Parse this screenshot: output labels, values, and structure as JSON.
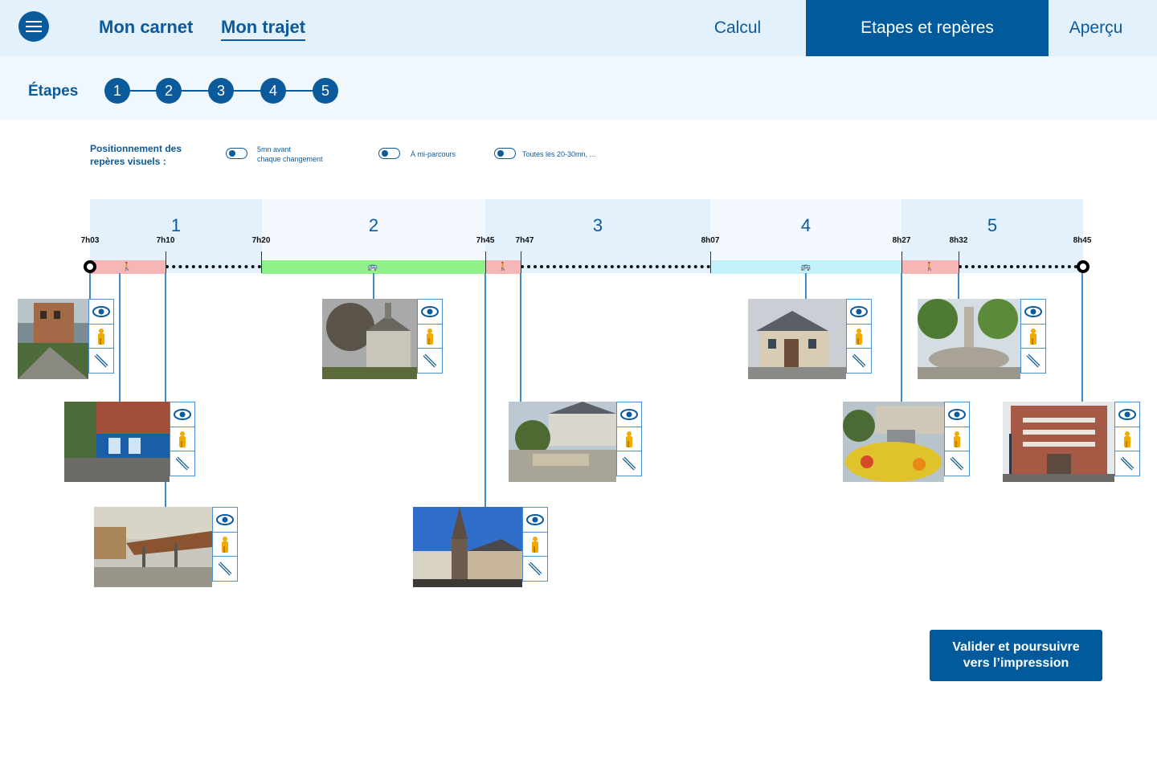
{
  "nav": {
    "menu_icon": "hamburger-icon",
    "links": [
      "Mon carnet",
      "Mon trajet"
    ],
    "tabs": [
      "Calcul",
      "Etapes et repères",
      "Aperçu"
    ]
  },
  "steps": {
    "label": "Étapes",
    "numbers": [
      "1",
      "2",
      "3",
      "4",
      "5"
    ]
  },
  "options": {
    "title": "Positionnement des repères visuels :",
    "items": [
      {
        "line1": "5mn avant",
        "line2": "chaque changement"
      },
      {
        "line1": "À mi-parcours",
        "line2": ""
      },
      {
        "line1": "Toutes les 20-30mn, ...",
        "line2": ""
      }
    ]
  },
  "timeline": {
    "segments": [
      {
        "num": "1",
        "mode": "walk-icon"
      },
      {
        "num": "2",
        "mode": "bus-icon"
      },
      {
        "num": "3",
        "mode": "walk-icon"
      },
      {
        "num": "4",
        "mode": "bus-icon"
      },
      {
        "num": "5",
        "mode": "walk-icon"
      }
    ],
    "times": [
      "7h03",
      "7h10",
      "7h20",
      "7h45",
      "7h47",
      "8h07",
      "8h27",
      "8h32",
      "8h45"
    ],
    "colors": {
      "walk": "#f7b6b6",
      "bus_green": "#8ef18a",
      "bus_cyan": "#c3f2fc",
      "accent": "#005a9c"
    }
  },
  "landmark_actions": [
    "eye-icon",
    "person-icon",
    "ruler-icon"
  ],
  "cta": {
    "line1": "Valider et poursuivre",
    "line2": "vers l’impression"
  }
}
